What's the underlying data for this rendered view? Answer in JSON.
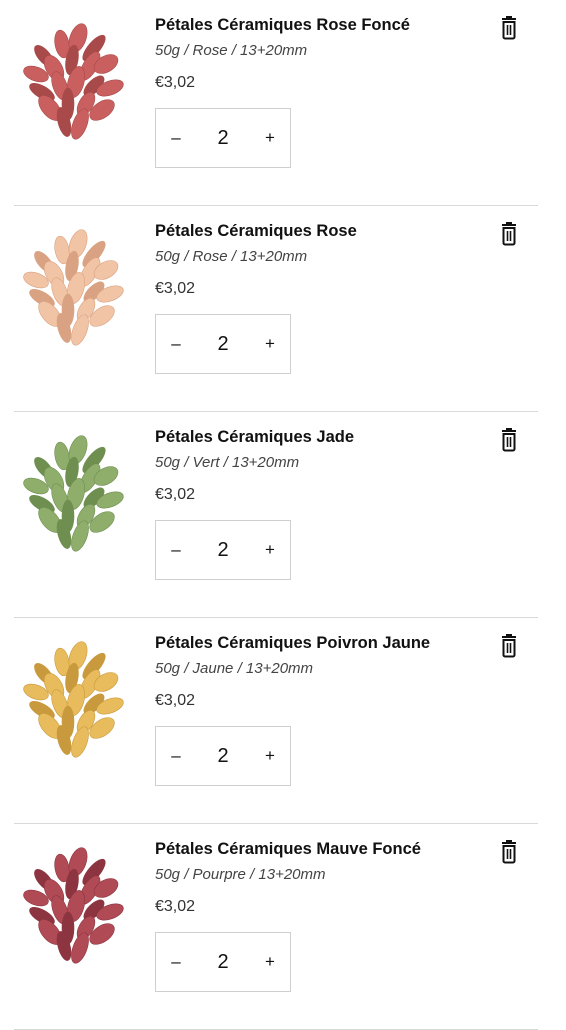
{
  "items": [
    {
      "title": "Pétales Céramiques Rose Foncé",
      "variant": "50g / Rose / 13+20mm",
      "price": "€3,02",
      "quantity": "2",
      "color": "#c9605f",
      "shade": "#a84a4a"
    },
    {
      "title": "Pétales Céramiques Rose",
      "variant": "50g / Rose / 13+20mm",
      "price": "€3,02",
      "quantity": "2",
      "color": "#f2c4a6",
      "shade": "#d9a282"
    },
    {
      "title": "Pétales Céramiques Jade",
      "variant": "50g / Vert / 13+20mm",
      "price": "€3,02",
      "quantity": "2",
      "color": "#8fae6c",
      "shade": "#6f8f51"
    },
    {
      "title": "Pétales Céramiques Poivron Jaune",
      "variant": "50g / Jaune / 13+20mm",
      "price": "€3,02",
      "quantity": "2",
      "color": "#e8bc5c",
      "shade": "#c99a3d"
    },
    {
      "title": "Pétales Céramiques Mauve Foncé",
      "variant": "50g / Pourpre / 13+20mm",
      "price": "€3,02",
      "quantity": "2",
      "color": "#b04a55",
      "shade": "#8c3540"
    }
  ],
  "controls": {
    "decrement_label": "–",
    "increment_label": "+"
  },
  "icons": {
    "remove": "trash-icon",
    "product": "petal-cluster-icon"
  }
}
